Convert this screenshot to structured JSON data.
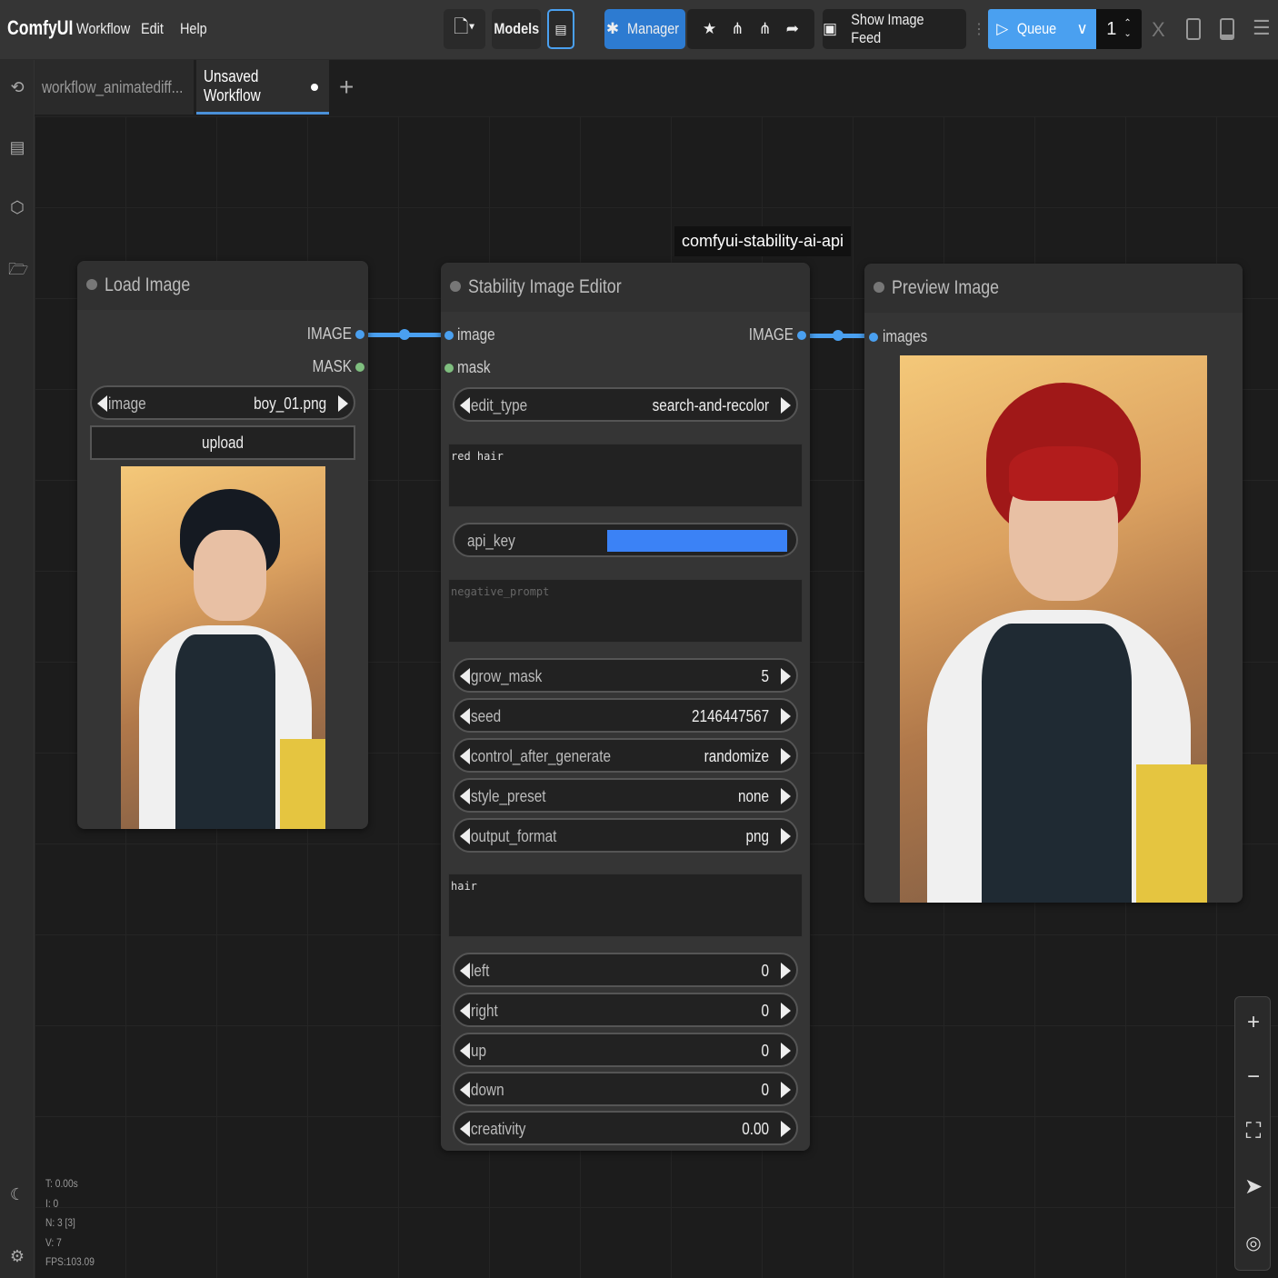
{
  "app": {
    "brand": "ComfyUI"
  },
  "menu": [
    "Workflow",
    "Edit",
    "Help"
  ],
  "toolbar": {
    "models": "Models",
    "manager": "Manager",
    "show_image_feed": "Show Image Feed",
    "queue": "Queue",
    "queue_count": "1",
    "close": "X"
  },
  "tabs": [
    {
      "label": "workflow_animatediff..."
    },
    {
      "label": "Unsaved Workflow"
    }
  ],
  "tooltip": "comfyui-stability-ai-api",
  "load_image": {
    "title": "Load Image",
    "outputs": [
      "IMAGE",
      "MASK"
    ],
    "image_widget": {
      "label": "image",
      "value": "boy_01.png"
    },
    "upload": "upload"
  },
  "editor": {
    "title": "Stability Image Editor",
    "inputs": [
      "image",
      "mask"
    ],
    "output": "IMAGE",
    "edit_type": {
      "label": "edit_type",
      "value": "search-and-recolor"
    },
    "prompt": "red hair",
    "api_key": "api_key",
    "negative_prompt": "negative_prompt",
    "grow_mask": {
      "label": "grow_mask",
      "value": "5"
    },
    "seed": {
      "label": "seed",
      "value": "2146447567"
    },
    "control_after_generate": {
      "label": "control_after_generate",
      "value": "randomize"
    },
    "style_preset": {
      "label": "style_preset",
      "value": "none"
    },
    "output_format": {
      "label": "output_format",
      "value": "png"
    },
    "select_prompt": "hair",
    "left": {
      "label": "left",
      "value": "0"
    },
    "right": {
      "label": "right",
      "value": "0"
    },
    "up": {
      "label": "up",
      "value": "0"
    },
    "down": {
      "label": "down",
      "value": "0"
    },
    "creativity": {
      "label": "creativity",
      "value": "0.00"
    }
  },
  "preview": {
    "title": "Preview Image",
    "input": "images"
  },
  "stats": {
    "t": "T: 0.00s",
    "i": "I: 0",
    "n": "N: 3 [3]",
    "v": "V: 7",
    "fps": "FPS:103.09"
  },
  "colors": {
    "accent": "#4aa0f0",
    "manager": "#2d7bd1",
    "api_key_bar": "#3b82f6",
    "mask_slot": "#7fbf7f"
  }
}
